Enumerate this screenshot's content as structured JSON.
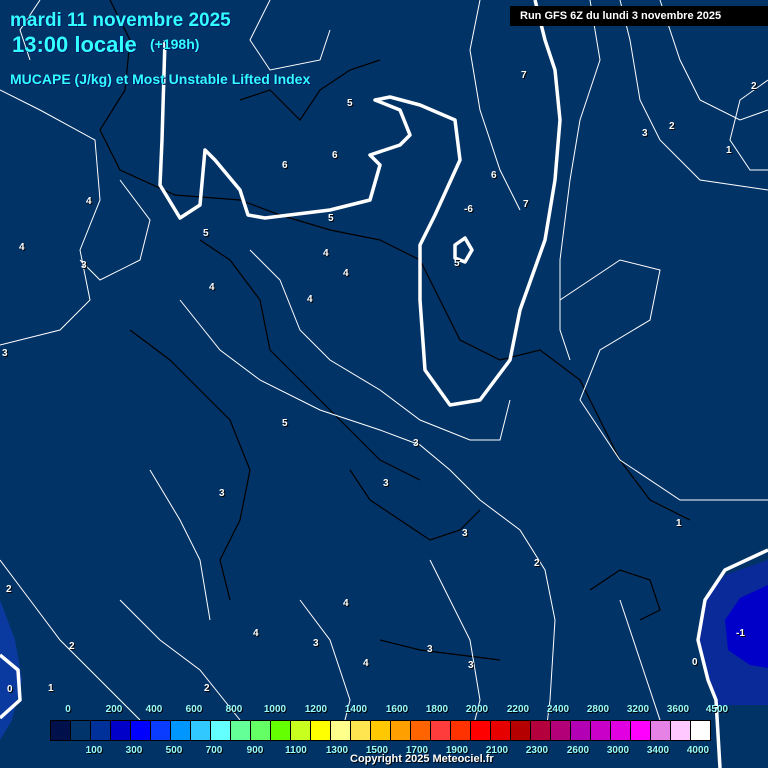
{
  "header": {
    "date": "mardi 11 novembre 2025",
    "time": "13:00 locale",
    "lead": "(+198h)",
    "parameter": "MUCAPE (J/kg) et Most Unstable Lifted Index",
    "run": "Run GFS 6Z du lundi 3 novembre 2025"
  },
  "contour_labels": [
    "5",
    "6",
    "6",
    "5",
    "4",
    "5",
    "4",
    "3",
    "4",
    "4",
    "4",
    "4",
    "3",
    "7",
    "2",
    "3",
    "2",
    "1",
    "6",
    "7",
    "-6",
    "5",
    "5",
    "3",
    "3",
    "3",
    "3",
    "1",
    "2",
    "2",
    "4",
    "4",
    "3",
    "2",
    "-1",
    "4",
    "3",
    "3",
    "0",
    "0",
    "1",
    "2"
  ],
  "legend": {
    "colors": [
      "#00104a",
      "#00346a",
      "#00309a",
      "#0000c8",
      "#0000ff",
      "#0a3cff",
      "#0096ff",
      "#30c8ff",
      "#64ffff",
      "#64ff96",
      "#64ff64",
      "#64ff00",
      "#c8ff1e",
      "#ffff00",
      "#ffff8c",
      "#ffe650",
      "#ffc800",
      "#ffa000",
      "#ff6400",
      "#ff3c3c",
      "#ff3200",
      "#ff0000",
      "#e60000",
      "#b40000",
      "#b4003c",
      "#b40078",
      "#b400b4",
      "#c800c8",
      "#e100e1",
      "#ff00ff",
      "#e682e6",
      "#ffc8ff",
      "#ffffff"
    ],
    "top_labels": [
      "0",
      "200",
      "400",
      "600",
      "800",
      "1000",
      "1200",
      "1400",
      "1600",
      "1800",
      "2000",
      "2200",
      "2400",
      "2800",
      "3200",
      "3600",
      "4500"
    ],
    "bottom_labels": [
      "100",
      "300",
      "500",
      "700",
      "900",
      "1100",
      "1300",
      "1500",
      "1700",
      "1900",
      "2100",
      "2300",
      "2600",
      "3000",
      "3400",
      "4000"
    ]
  },
  "copyright": "Copyright 2025 Meteociel.fr"
}
